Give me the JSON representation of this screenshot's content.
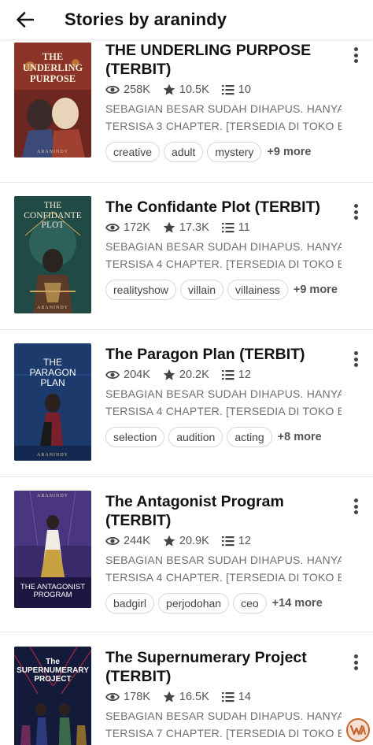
{
  "header": {
    "title": "Stories by aranindy"
  },
  "stories": [
    {
      "title": "THE UNDERLING PURPOSE (TERBIT)",
      "reads": "258K",
      "votes": "10.5K",
      "parts": "10",
      "description": "SEBAGIAN BESAR SUDAH DIHAPUS. HANYA TERSISA 3 CHAPTER. [TERSEDIA DI TOKO B...",
      "desc_line1": "SEBAGIAN BESAR SUDAH DIHAPUS. HANYA",
      "desc_line2": "TERSISA 3 CHAPTER. [TERSEDIA DI TOKO B...",
      "tags": [
        "creative",
        "adult",
        "mystery"
      ],
      "more_tags": "+9 more",
      "cover_title": "THE UNDERLING PURPOSE",
      "cover_author": "ARANINDY",
      "cover_bg": "#7a2a22"
    },
    {
      "title": "The Confidante Plot (TERBIT)",
      "reads": "172K",
      "votes": "17.3K",
      "parts": "11",
      "desc_line1": "SEBAGIAN BESAR SUDAH DIHAPUS. HANYA",
      "desc_line2": "TERSISA 4 CHAPTER. [TERSEDIA DI TOKO B...",
      "tags": [
        "realityshow",
        "villain",
        "villainess"
      ],
      "more_tags": "+9 more",
      "cover_title": "THE CONFIDANTE PLOT",
      "cover_author": "ARANINDY",
      "cover_bg": "#1f4a45"
    },
    {
      "title": "The Paragon Plan (TERBIT)",
      "reads": "204K",
      "votes": "20.2K",
      "parts": "12",
      "desc_line1": "SEBAGIAN BESAR SUDAH DIHAPUS. HANYA",
      "desc_line2": "TERSISA 4 CHAPTER. [TERSEDIA DI TOKO B...",
      "tags": [
        "selection",
        "audition",
        "acting"
      ],
      "more_tags": "+8 more",
      "cover_title": "THE PARAGON PLAN",
      "cover_author": "ARANINDY",
      "cover_bg": "#1c3a6b"
    },
    {
      "title": "The Antagonist Program (TERBIT)",
      "reads": "244K",
      "votes": "20.9K",
      "parts": "12",
      "desc_line1": "SEBAGIAN BESAR SUDAH DIHAPUS. HANYA",
      "desc_line2": "TERSISA 4 CHAPTER. [TERSEDIA DI TOKO B...",
      "tags": [
        "badgirl",
        "perjodohan",
        "ceo"
      ],
      "more_tags": "+14 more",
      "cover_title": "THE ANTAGONIST PROGRAM",
      "cover_author": "ARANINDY",
      "cover_bg": "#3a2a6a"
    },
    {
      "title": "The Supernumerary Project (TERBIT)",
      "reads": "178K",
      "votes": "16.5K",
      "parts": "14",
      "desc_line1": "SEBAGIAN BESAR SUDAH DIHAPUS. HANYA",
      "desc_line2": "TERSISA 7 CHAPTER. [TERSEDIA DI TOKO B...",
      "tags": [],
      "more_tags": "",
      "cover_title": "The SUPERNUMERARY PROJECT",
      "cover_author": "",
      "cover_bg": "#141a3a"
    }
  ],
  "icons": {
    "back": "arrow-left-icon",
    "reads": "eye-icon",
    "votes": "star-icon",
    "parts": "list-icon",
    "menu": "more-vertical-icon"
  },
  "colors": {
    "text": "#121212",
    "meta": "#555555",
    "description": "#6f6f6f",
    "divider": "#e4e4e4"
  }
}
